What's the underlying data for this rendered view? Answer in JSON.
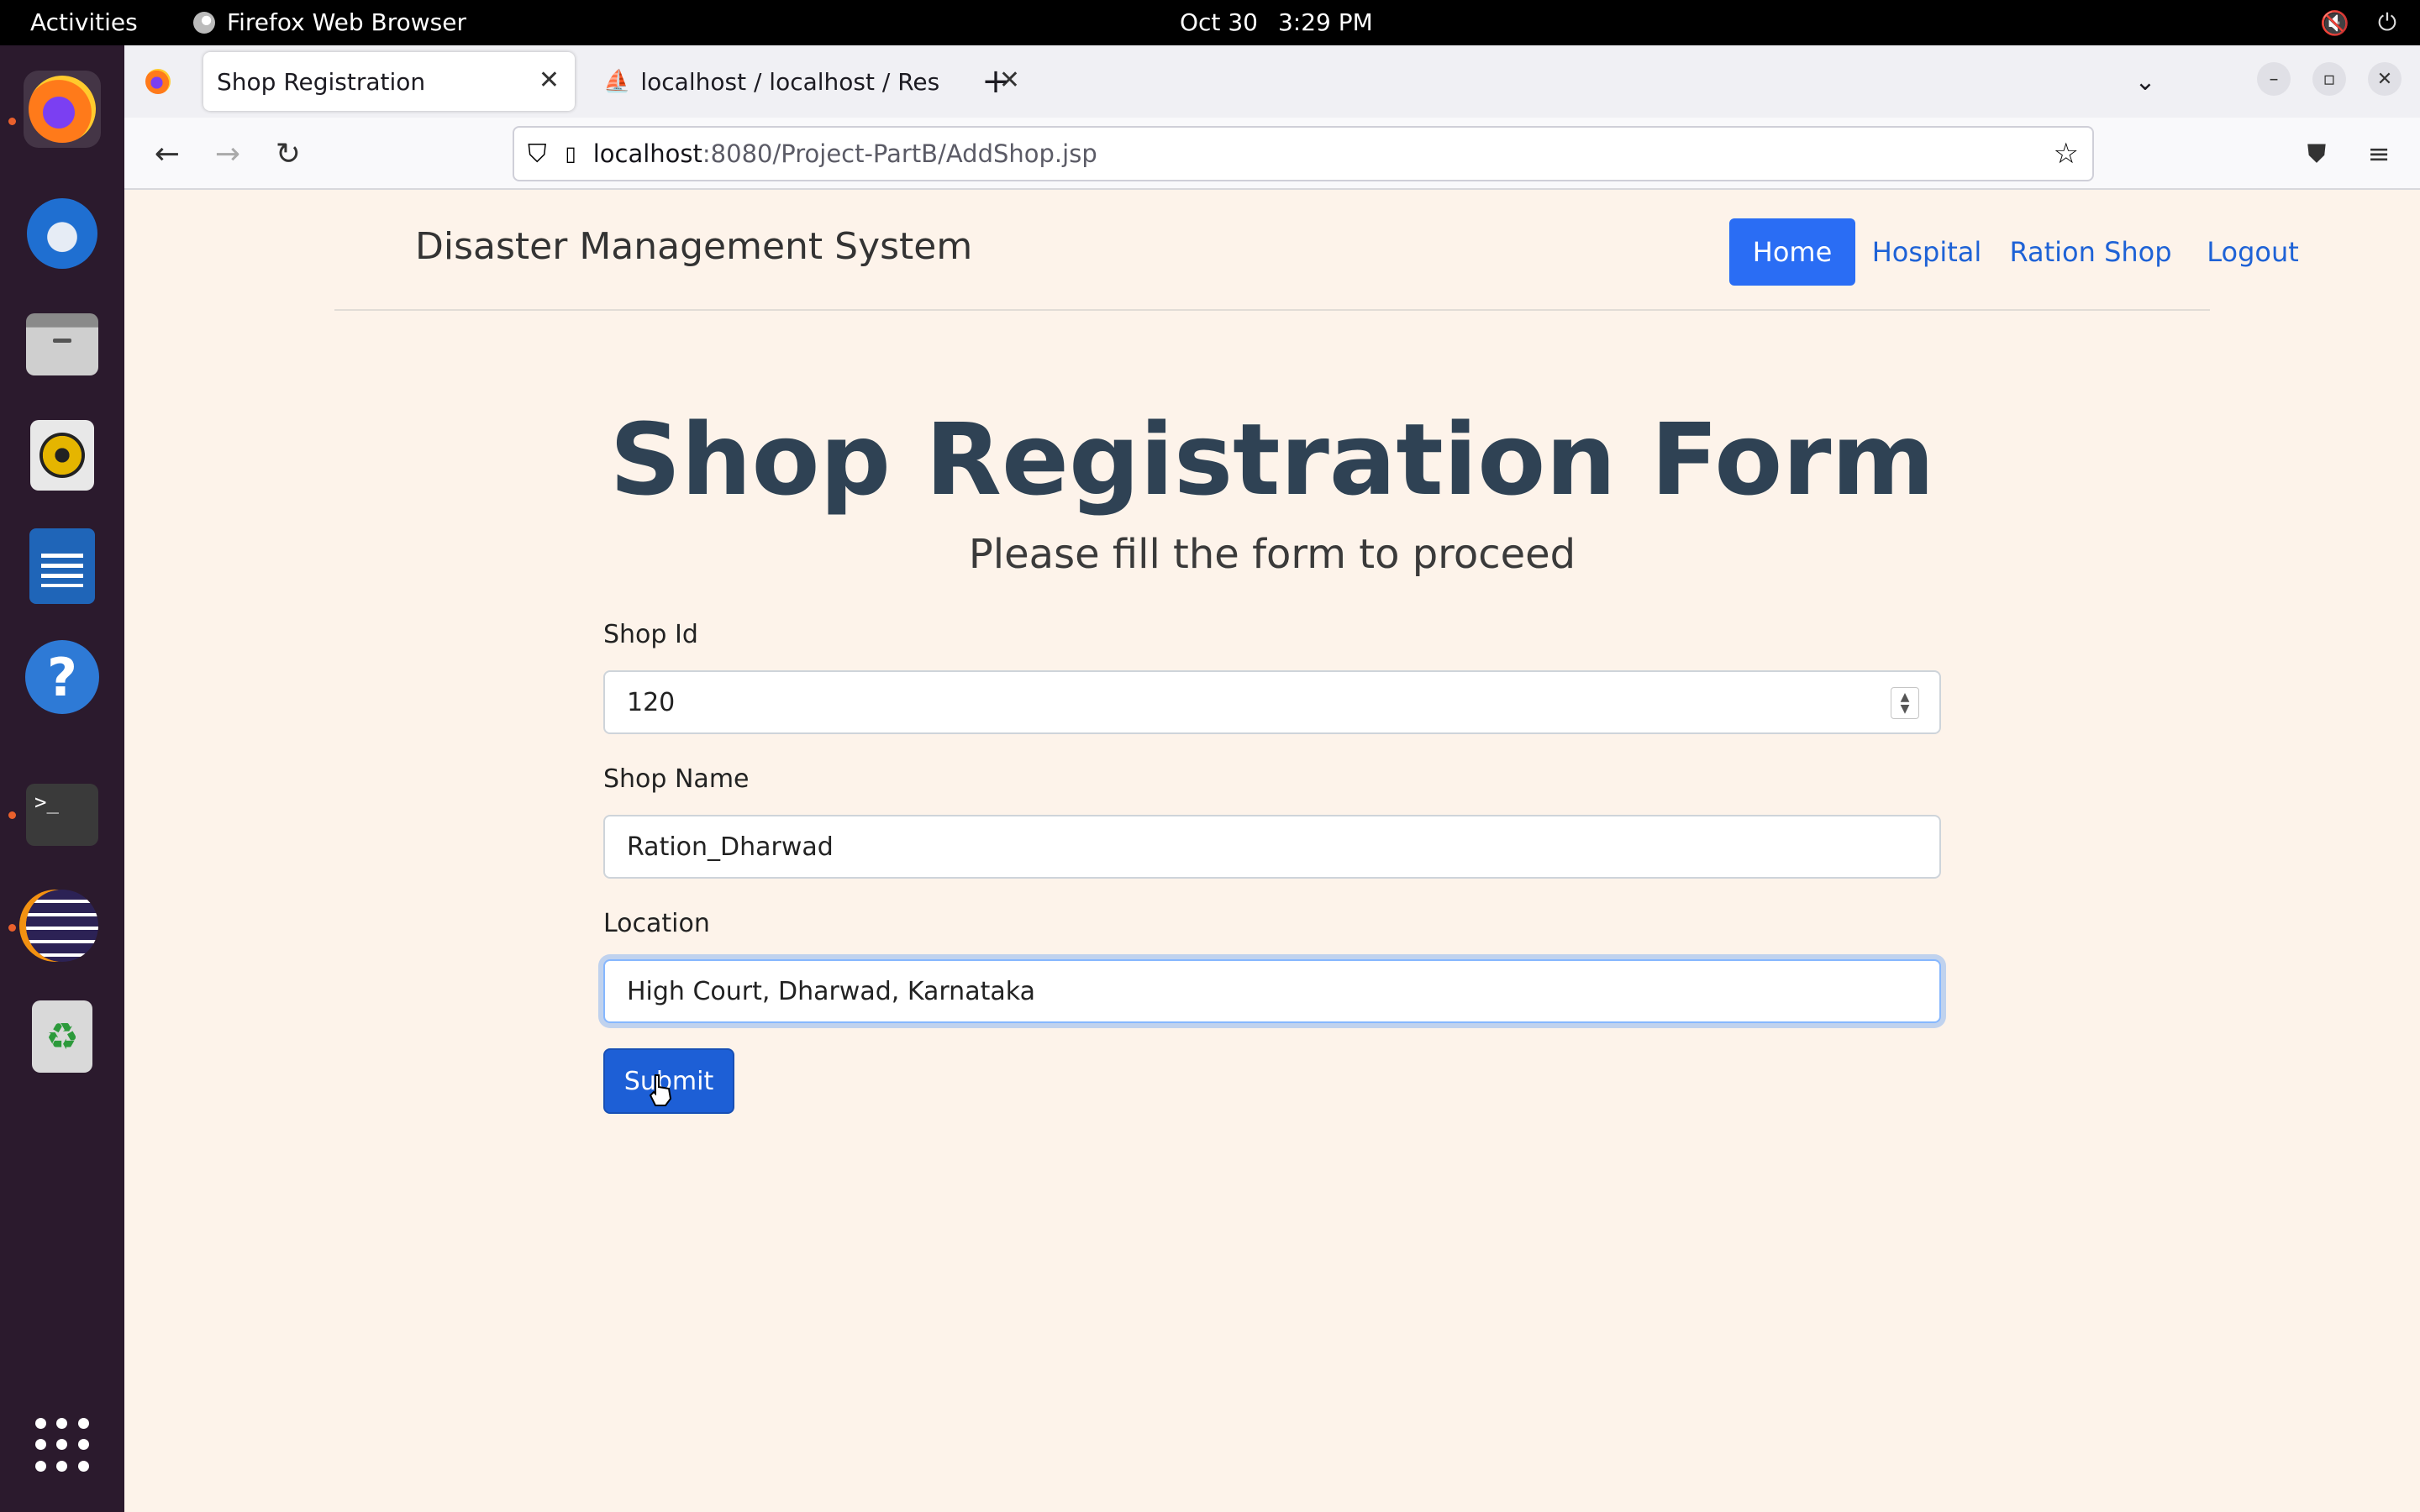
{
  "topbar": {
    "activities": "Activities",
    "app_name": "Firefox Web Browser",
    "date": "Oct 30",
    "time": "3:29 PM"
  },
  "dock": {
    "items": [
      "firefox",
      "thunderbird",
      "files",
      "rhythmbox",
      "libreoffice-writer",
      "help",
      "terminal",
      "eclipse",
      "trash",
      "show-apps"
    ]
  },
  "browser": {
    "tabs": [
      {
        "title": "Shop Registration",
        "active": true
      },
      {
        "title": "localhost / localhost / Res",
        "active": false
      }
    ],
    "url_host": "localhost",
    "url_path": ":8080/Project-PartB/AddShop.jsp"
  },
  "site": {
    "brand": "Disaster Management System",
    "nav": {
      "home": "Home",
      "hospital": "Hospital",
      "ration_shop": "Ration Shop",
      "logout": "Logout"
    }
  },
  "form": {
    "title": "Shop Registration Form",
    "subtitle": "Please fill the form to proceed",
    "shop_id_label": "Shop Id",
    "shop_id_value": "120",
    "shop_name_label": "Shop Name",
    "shop_name_value": "Ration_Dharwad",
    "location_label": "Location",
    "location_value": "High Court, Dharwad, Karnataka",
    "submit_label": "Submit"
  },
  "colors": {
    "accent": "#2a6df4",
    "page_bg": "#fdf3ea",
    "title": "#2f4254"
  }
}
